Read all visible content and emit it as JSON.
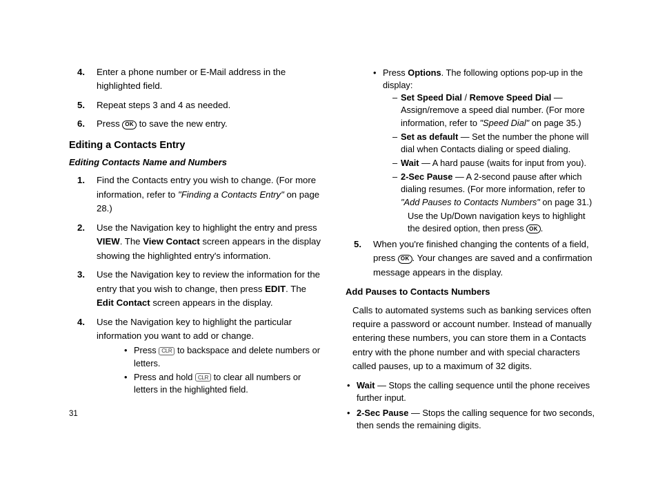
{
  "pageNumber": "31",
  "icons": {
    "ok": "OK",
    "clr": "CLR"
  },
  "left": {
    "steps456": [
      {
        "num": "4.",
        "body": "Enter a phone number or E-Mail address in the highlighted field."
      },
      {
        "num": "5.",
        "body": "Repeat steps 3 and 4 as needed."
      },
      {
        "num": "6.",
        "prefix": "Press ",
        "suffix": " to save the new entry."
      }
    ],
    "h2": "Editing a Contacts Entry",
    "h3": "Editing Contacts Name and Numbers",
    "edit_steps": [
      {
        "num": "1.",
        "t1": "Find the Contacts entry you wish to change. (For more information, refer to ",
        "ref": "\"Finding a Contacts Entry\"",
        "t2": "  on page 28.)"
      },
      {
        "num": "2.",
        "t1": "Use the Navigation key to highlight the entry and press ",
        "b1": "VIEW",
        "t2": ". The ",
        "b2": "View Contact",
        "t3": " screen appears in the display showing the highlighted entry's information."
      },
      {
        "num": "3.",
        "t1": "Use the Navigation key to review the information for the entry that you wish to change, then press ",
        "b1": "EDIT",
        "t2": ". The ",
        "b2": "Edit Contact",
        "t3": " screen appears in the display."
      },
      {
        "num": "4.",
        "t1": "Use the Navigation key to highlight the particular information you want to add or change."
      }
    ],
    "sub_bullets": [
      {
        "pre": "Press ",
        "post": " to backspace and delete numbers or letters."
      },
      {
        "pre": "Press and hold ",
        "post": " to clear all numbers or letters in the highlighted field."
      }
    ]
  },
  "right": {
    "top_bullet": {
      "t1": "Press ",
      "b1": "Options",
      "t2": ". The following options pop-up in the display:"
    },
    "dash": [
      {
        "b1": "Set Speed Dial",
        "slash": " / ",
        "b2": "Remove Speed Dial",
        "t1": " — Assign/remove a speed dial number. (For more information, refer to ",
        "ref": "\"Speed Dial\"",
        "t2": "  on page 35.)"
      },
      {
        "b1": "Set as default",
        "t1": " — Set the number the phone will dial when Contacts dialing or speed dialing."
      },
      {
        "b1": "Wait",
        "t1": " — A hard pause (waits for input from you)."
      },
      {
        "b1": "2-Sec Pause",
        "t1": " — A 2-second pause after which dialing resumes. (For more information, refer to ",
        "ref": "\"Add Pauses to Contacts Numbers\"",
        "t2": "  on page 31.)"
      }
    ],
    "note": {
      "t1": "Use the Up/Down navigation keys to highlight the desired option, then press ",
      "t2": "."
    },
    "step5": {
      "num": "5.",
      "t1": "When you're finished changing the contents of a field, press ",
      "t2": ". Your changes are saved and a confirmation message appears in the display."
    },
    "h3": "Add Pauses to Contacts Numbers",
    "para": "Calls to automated systems such as banking services often require a password or account number. Instead of manually entering these numbers, you can store them in a Contacts entry with the phone number and with special characters called pauses, up to a maximum of 32 digits.",
    "pause_bullets": [
      {
        "b": "Wait",
        "t": " — Stops the calling sequence until the phone receives further input."
      },
      {
        "b": "2-Sec Pause",
        "t": " — Stops the calling sequence for two seconds, then sends the remaining digits."
      }
    ]
  }
}
